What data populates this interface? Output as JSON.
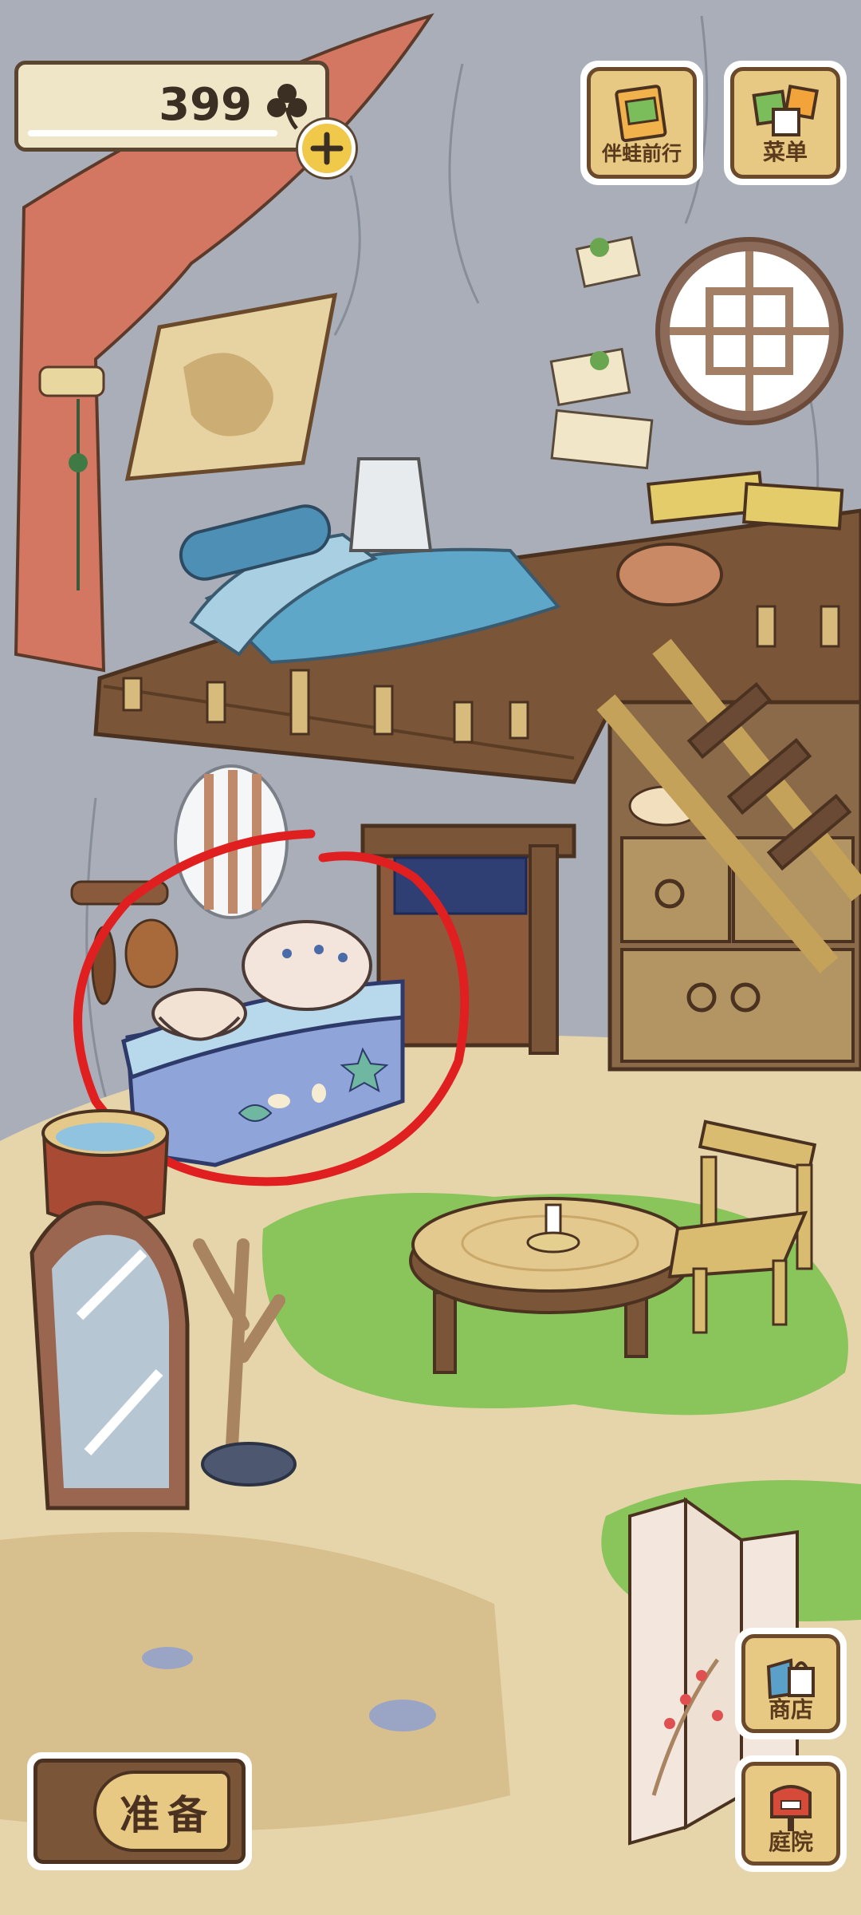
{
  "hud": {
    "clover_count": "399",
    "add_icon": "plus-icon",
    "clover_icon": "clover-icon"
  },
  "buttons": {
    "travel_label": "伴蛙前行",
    "menu_label": "菜单",
    "shop_label": "商店",
    "yard_label": "庭院",
    "prepare_label": "准备"
  },
  "colors": {
    "wall": "#a7adb8",
    "floor": "#e4d3a8",
    "grass": "#88c25a",
    "curtain": "#d47762",
    "wood": "#7a5537",
    "button_fill": "#e8c983",
    "annotation": "#e02020"
  }
}
